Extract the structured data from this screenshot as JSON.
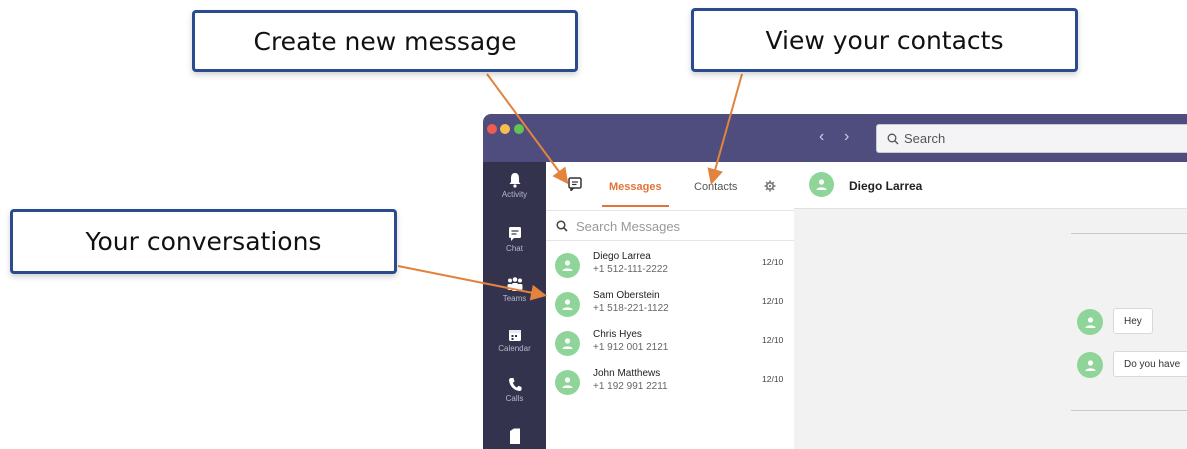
{
  "annotations": {
    "create_new_message": "Create new message",
    "view_contacts": "View your contacts",
    "your_conversations": "Your conversations"
  },
  "app": {
    "search_placeholder": "Search",
    "rail": [
      {
        "label": "Activity",
        "icon": "bell-icon"
      },
      {
        "label": "Chat",
        "icon": "chat-icon"
      },
      {
        "label": "Teams",
        "icon": "teams-icon"
      },
      {
        "label": "Calendar",
        "icon": "calendar-icon"
      },
      {
        "label": "Calls",
        "icon": "phone-icon"
      },
      {
        "label": "",
        "icon": "files-icon"
      }
    ],
    "tabs": {
      "messages": "Messages",
      "contacts": "Contacts",
      "active": "Messages"
    },
    "search_messages_placeholder": "Search Messages",
    "conversations": [
      {
        "name": "Diego Larrea",
        "phone": "+1 512-111-2222",
        "date": "12/10"
      },
      {
        "name": "Sam Oberstein",
        "phone": "+1 518-221-1122",
        "date": "12/10"
      },
      {
        "name": "Chris Hyes",
        "phone": "+1 912 001 2121",
        "date": "12/10"
      },
      {
        "name": "John Matthews",
        "phone": "+1 192 991 2211",
        "date": "12/10"
      }
    ],
    "chat": {
      "contact_name": "Diego Larrea",
      "messages": [
        "Hey",
        "Do you have"
      ]
    },
    "colors": {
      "titlebar": "#4e4d7e",
      "rail": "#33334d",
      "accent": "#e3733a",
      "avatar": "#8fd59a",
      "callout_border": "#2a4c8f"
    }
  }
}
